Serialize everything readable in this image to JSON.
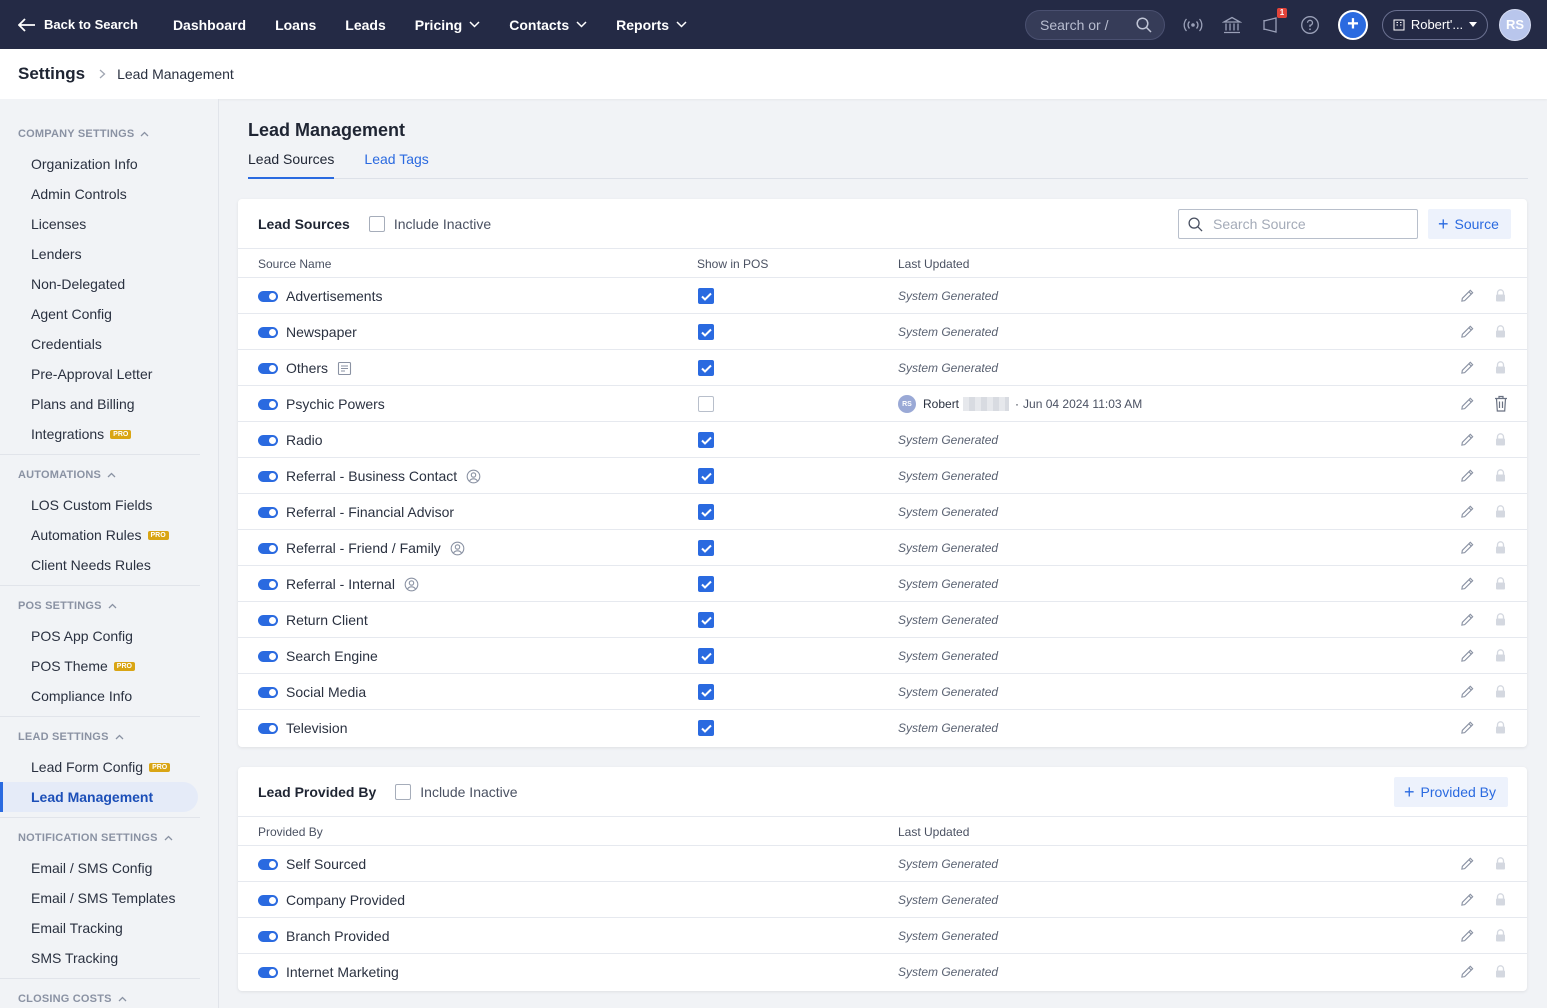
{
  "topnav": {
    "back_label": "Back to Search",
    "links": [
      "Dashboard",
      "Loans",
      "Leads",
      "Pricing",
      "Contacts",
      "Reports"
    ],
    "search_placeholder": "Search or /",
    "notification_count": "1",
    "user_label": "Robert'...",
    "avatar_initials": "RS"
  },
  "breadcrumb": {
    "title": "Settings",
    "current": "Lead Management"
  },
  "sidebar": {
    "company": {
      "heading": "COMPANY SETTINGS",
      "items": [
        "Organization Info",
        "Admin Controls",
        "Licenses",
        "Lenders",
        "Non-Delegated",
        "Agent Config",
        "Credentials",
        "Pre-Approval Letter",
        "Plans and Billing",
        "Integrations"
      ]
    },
    "automations": {
      "heading": "AUTOMATIONS",
      "items": [
        "LOS Custom Fields",
        "Automation Rules",
        "Client Needs Rules"
      ]
    },
    "pos": {
      "heading": "POS SETTINGS",
      "items": [
        "POS App Config",
        "POS Theme",
        "Compliance Info"
      ]
    },
    "lead": {
      "heading": "LEAD SETTINGS",
      "items": [
        "Lead Form Config",
        "Lead Management"
      ]
    },
    "notification": {
      "heading": "NOTIFICATION SETTINGS",
      "items": [
        "Email / SMS Config",
        "Email / SMS Templates",
        "Email Tracking",
        "SMS Tracking"
      ]
    },
    "closing": {
      "heading": "CLOSING COSTS"
    },
    "pro_badge": "PRO"
  },
  "page": {
    "title": "Lead Management",
    "tabs": [
      "Lead Sources",
      "Lead Tags"
    ]
  },
  "sources": {
    "title": "Lead Sources",
    "include_inactive": "Include Inactive",
    "search_placeholder": "Search Source",
    "add_label": "Source",
    "columns": {
      "name": "Source Name",
      "pos": "Show in POS",
      "updated": "Last Updated"
    },
    "rows": [
      {
        "name": "Advertisements",
        "pos": true,
        "updated": "System Generated",
        "extra": "",
        "locked": true
      },
      {
        "name": "Newspaper",
        "pos": true,
        "updated": "System Generated",
        "extra": "",
        "locked": true
      },
      {
        "name": "Others",
        "pos": true,
        "updated": "System Generated",
        "extra": "note",
        "locked": true
      },
      {
        "name": "Psychic Powers",
        "pos": false,
        "updated": "",
        "extra": "",
        "locked": false
      },
      {
        "name": "Radio",
        "pos": true,
        "updated": "System Generated",
        "extra": "",
        "locked": true
      },
      {
        "name": "Referral - Business Contact",
        "pos": true,
        "updated": "System Generated",
        "extra": "person",
        "locked": true
      },
      {
        "name": "Referral - Financial Advisor",
        "pos": true,
        "updated": "System Generated",
        "extra": "",
        "locked": true
      },
      {
        "name": "Referral - Friend / Family",
        "pos": true,
        "updated": "System Generated",
        "extra": "person",
        "locked": true
      },
      {
        "name": "Referral - Internal",
        "pos": true,
        "updated": "System Generated",
        "extra": "person",
        "locked": true
      },
      {
        "name": "Return Client",
        "pos": true,
        "updated": "System Generated",
        "extra": "",
        "locked": true
      },
      {
        "name": "Search Engine",
        "pos": true,
        "updated": "System Generated",
        "extra": "",
        "locked": true
      },
      {
        "name": "Social Media",
        "pos": true,
        "updated": "System Generated",
        "extra": "",
        "locked": true
      },
      {
        "name": "Television",
        "pos": true,
        "updated": "System Generated",
        "extra": "",
        "locked": true
      }
    ],
    "custom_update": {
      "initials": "RS",
      "user": "Robert",
      "sep": "·",
      "time": "Jun 04 2024 11:03 AM"
    }
  },
  "provided": {
    "title": "Lead Provided By",
    "include_inactive": "Include Inactive",
    "add_label": "Provided By",
    "columns": {
      "name": "Provided By",
      "updated": "Last Updated"
    },
    "rows": [
      {
        "name": "Self Sourced",
        "updated": "System Generated"
      },
      {
        "name": "Company Provided",
        "updated": "System Generated"
      },
      {
        "name": "Branch Provided",
        "updated": "System Generated"
      },
      {
        "name": "Internet Marketing",
        "updated": "System Generated"
      }
    ]
  }
}
